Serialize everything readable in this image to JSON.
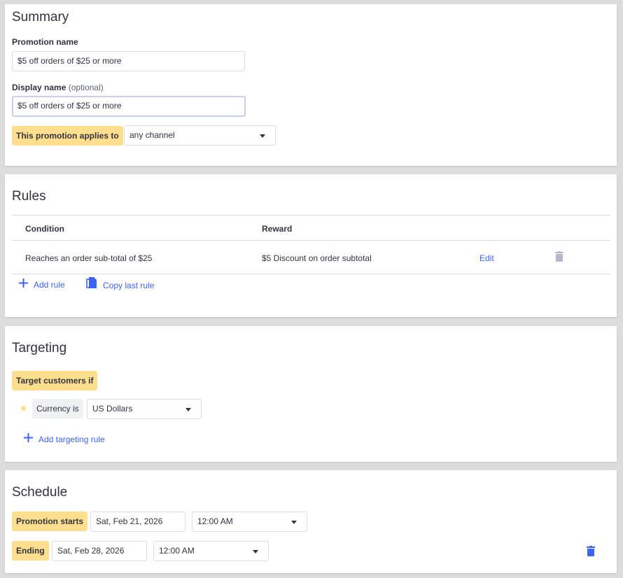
{
  "summary": {
    "title": "Summary",
    "promotion_name_label": "Promotion name",
    "promotion_name_value": "$5 off orders of $25 or more",
    "display_name_label": "Display name",
    "display_name_optional": "(optional)",
    "display_name_value": "$5 off orders of $25 or more",
    "applies_to_label": "This promotion applies to",
    "applies_to_value": "any channel"
  },
  "rules": {
    "title": "Rules",
    "columns": {
      "condition": "Condition",
      "reward": "Reward"
    },
    "rows": [
      {
        "condition": "Reaches an order sub-total of $25",
        "reward": "$5 Discount on order subtotal",
        "edit_label": "Edit"
      }
    ],
    "add_rule_label": "Add rule",
    "copy_last_rule_label": "Copy last rule"
  },
  "targeting": {
    "title": "Targeting",
    "target_label": "Target customers if",
    "condition_label": "Currency is",
    "condition_value": "US Dollars",
    "add_targeting_rule_label": "Add targeting rule"
  },
  "schedule": {
    "title": "Schedule",
    "starts_label": "Promotion starts",
    "start_date": "Sat, Feb 21, 2026",
    "start_time": "12:00 AM",
    "ending_label": "Ending",
    "end_date": "Sat, Feb 28, 2026",
    "end_time": "12:00 AM"
  },
  "colors": {
    "accent": "#3c64f4",
    "highlight": "#ffdf8d",
    "text": "#313440",
    "border": "#d9dce9",
    "trash_disabled": "#b4b8c8"
  }
}
